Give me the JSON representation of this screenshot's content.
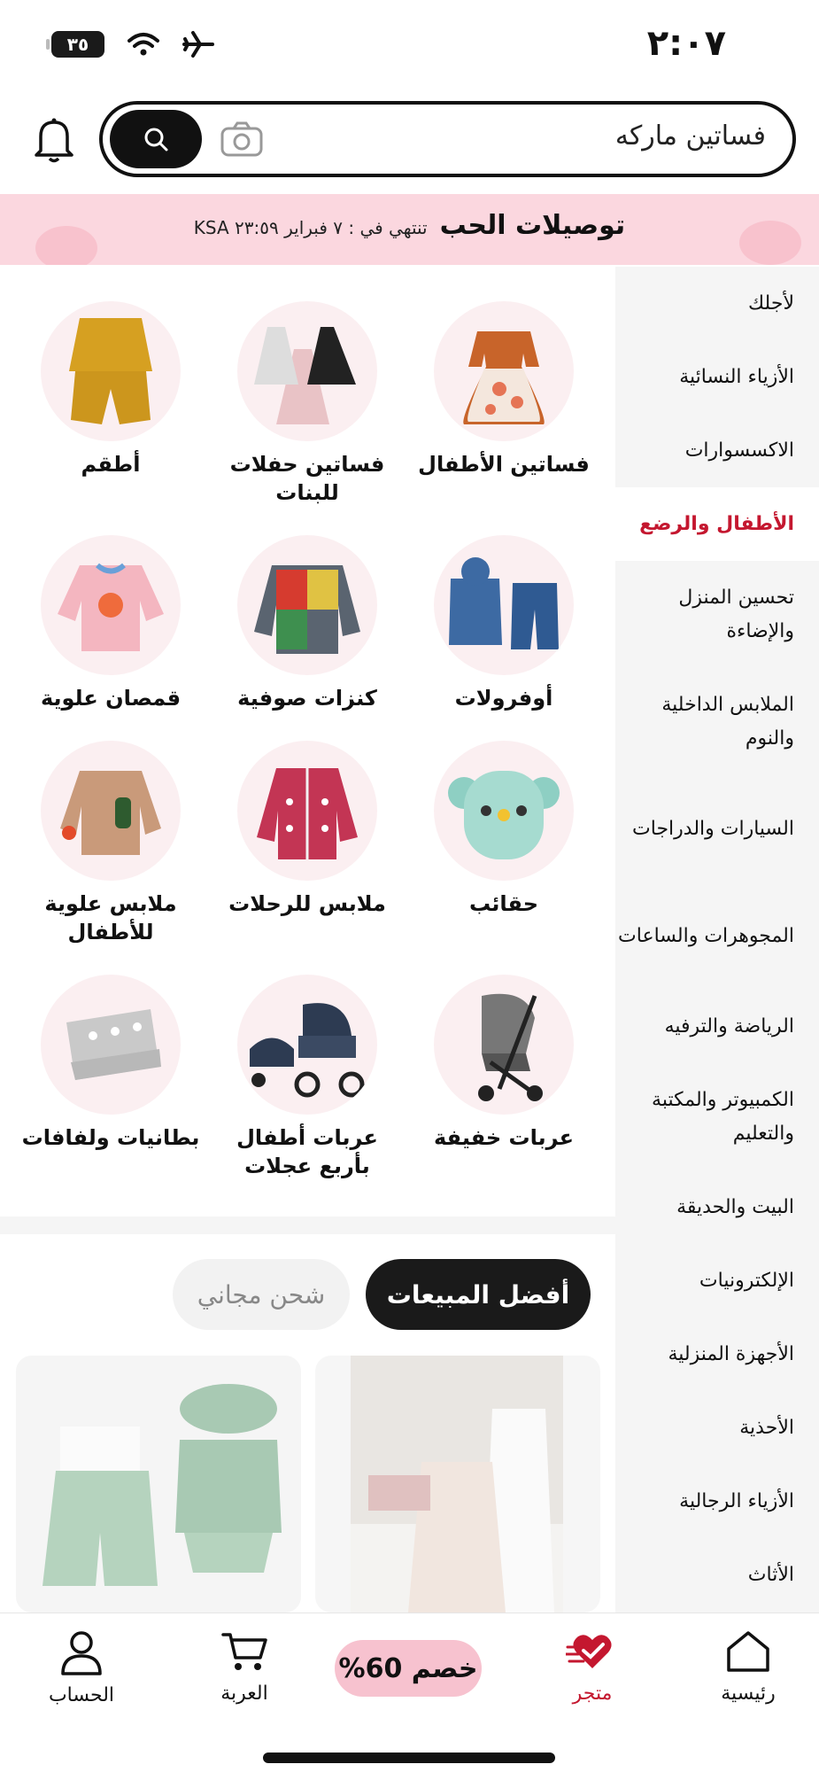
{
  "status_bar": {
    "time": "٢:٠٧",
    "battery": "٣٥"
  },
  "search": {
    "query": "فساتين ماركه"
  },
  "banner": {
    "title": "توصيلات الحب",
    "subtitle": "تنتهي في : ٧ فبراير ٢٣:٥٩ KSA"
  },
  "sidebar": {
    "items": [
      {
        "label": "لأجلك"
      },
      {
        "label": "الأزياء النسائية"
      },
      {
        "label": "الاكسسوارات"
      },
      {
        "label": "الأطفال والرضع",
        "active": true
      },
      {
        "label": "تحسين المنزل والإضاءة"
      },
      {
        "label": "الملابس الداخلية والنوم"
      },
      {
        "label": "السيارات والدراجات"
      },
      {
        "label": "المجوهرات والساعات"
      },
      {
        "label": "الرياضة والترفيه"
      },
      {
        "label": "الكمبيوتر والمكتبة والتعليم"
      },
      {
        "label": "البيت والحديقة"
      },
      {
        "label": "الإلكترونيات"
      },
      {
        "label": "الأجهزة المنزلية"
      },
      {
        "label": "الأحذية"
      },
      {
        "label": "الأزياء الرجالية"
      },
      {
        "label": "الأثاث"
      }
    ]
  },
  "categories": [
    {
      "label": "فساتين الأطفال",
      "icon": "kids-dress-icon"
    },
    {
      "label": "فساتين حفلات للبنات",
      "icon": "party-dress-icon"
    },
    {
      "label": "أطقم",
      "icon": "outfit-set-icon"
    },
    {
      "label": "أوفرولات",
      "icon": "overalls-icon"
    },
    {
      "label": "كنزات صوفية",
      "icon": "sweater-icon"
    },
    {
      "label": "قمصان علوية",
      "icon": "top-shirt-icon"
    },
    {
      "label": "حقائب",
      "icon": "bag-icon"
    },
    {
      "label": "ملابس للرحلات",
      "icon": "travel-jacket-icon"
    },
    {
      "label": "ملابس علوية للأطفال",
      "icon": "kids-top-icon"
    },
    {
      "label": "عربات خفيفة",
      "icon": "light-stroller-icon"
    },
    {
      "label": "عربات أطفال بأربع عجلات",
      "icon": "four-wheel-stroller-icon"
    },
    {
      "label": "بطانيات ولفافات",
      "icon": "blanket-icon"
    }
  ],
  "tabs": {
    "best_sellers": "أفضل المبيعات",
    "free_shipping": "شحن مجاني"
  },
  "bottom_nav": {
    "home": "رئيسية",
    "store": "متجر",
    "discount": "خصم 60%",
    "cart": "العربة",
    "account": "الحساب"
  },
  "colors": {
    "accent": "#c4172f",
    "banner_bg": "#fbd7df",
    "discount_bg": "#f7c2cf"
  }
}
